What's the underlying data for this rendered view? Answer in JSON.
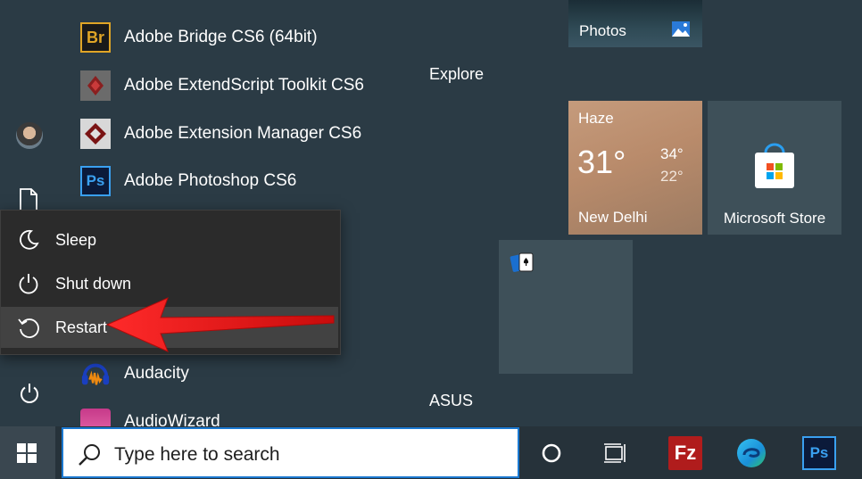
{
  "apps": [
    {
      "label": "Adobe Bridge CS6 (64bit)",
      "icon_text": "Br",
      "icon": "bridge-icon"
    },
    {
      "label": "Adobe ExtendScript Toolkit CS6",
      "icon_text": "",
      "icon": "extendscript-icon"
    },
    {
      "label": "Adobe Extension Manager CS6",
      "icon_text": "",
      "icon": "extension-manager-icon"
    },
    {
      "label": "Adobe Photoshop CS6",
      "icon_text": "Ps",
      "icon": "photoshop-icon"
    },
    {
      "label": "Audacity",
      "icon_text": "",
      "icon": "audacity-icon"
    },
    {
      "label": "AudioWizard",
      "icon_text": "",
      "icon": "audiowizard-icon"
    }
  ],
  "power_menu": {
    "items": [
      {
        "label": "Sleep",
        "icon": "moon-icon"
      },
      {
        "label": "Shut down",
        "icon": "power-icon"
      },
      {
        "label": "Restart",
        "icon": "restart-icon"
      }
    ]
  },
  "groups": {
    "explore": "Explore",
    "asus": "ASUS"
  },
  "tiles": {
    "photos": "Photos",
    "weather": {
      "condition": "Haze",
      "temp": "31°",
      "high": "34°",
      "low": "22°",
      "city": "New Delhi"
    },
    "store": "Microsoft Store"
  },
  "taskbar": {
    "search_placeholder": "Type here to search",
    "filezilla_text": "Fz",
    "photoshop_text": "Ps"
  },
  "colors": {
    "accent": "#1a78d0",
    "arrow": "#e01818",
    "menu_bg": "#2b2b2b"
  }
}
